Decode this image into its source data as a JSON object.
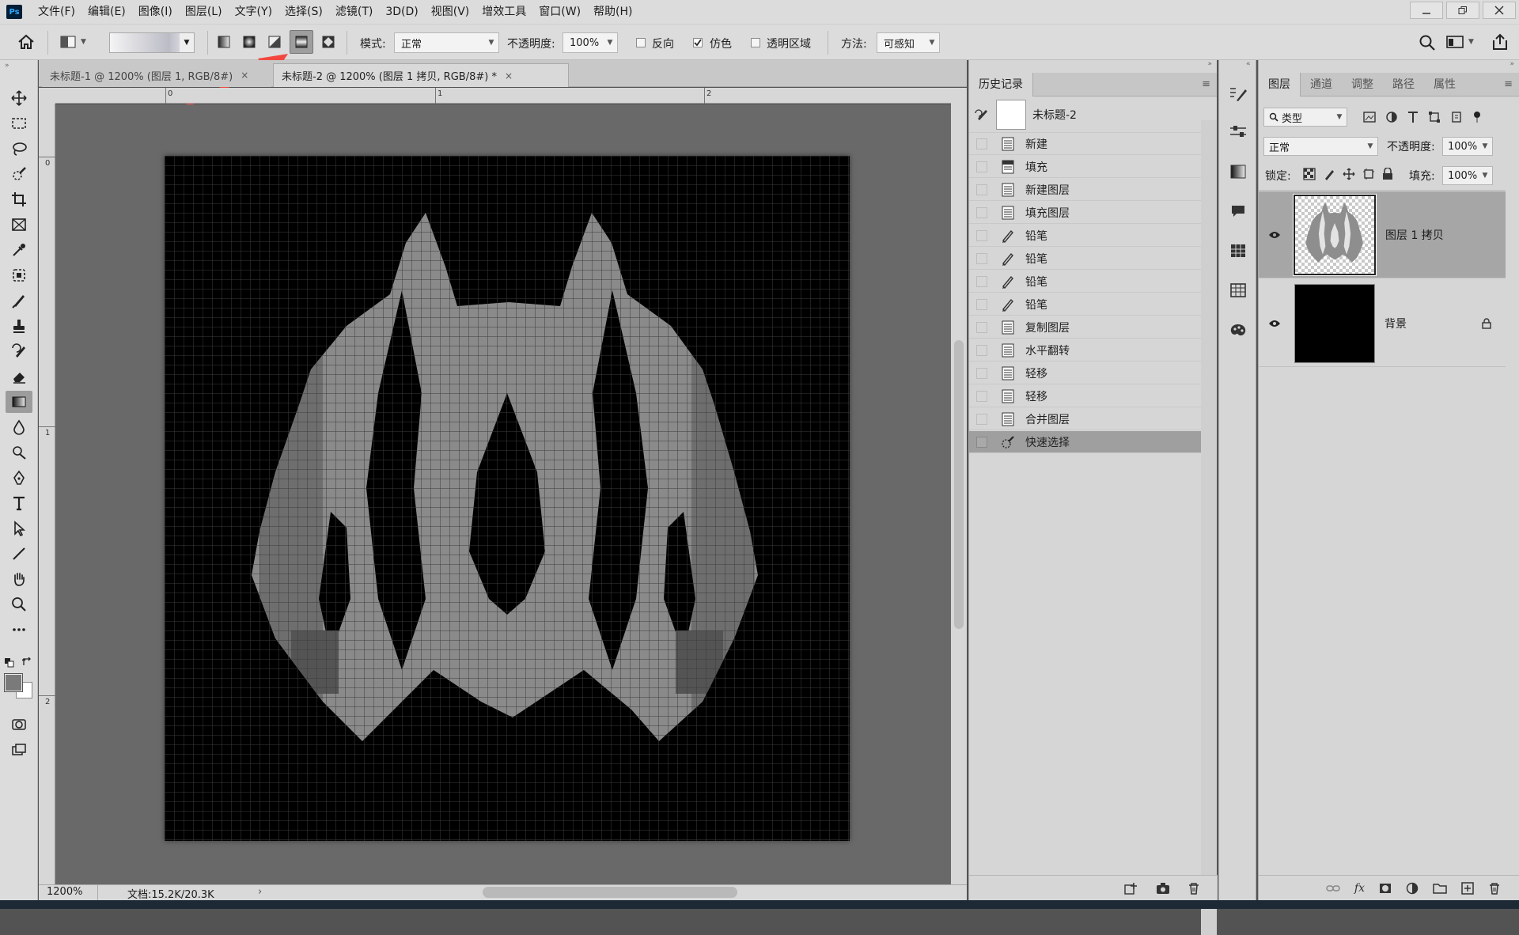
{
  "app": {
    "logo": "Ps"
  },
  "menu": [
    "文件(F)",
    "编辑(E)",
    "图像(I)",
    "图层(L)",
    "文字(Y)",
    "选择(S)",
    "滤镜(T)",
    "3D(D)",
    "视图(V)",
    "增效工具",
    "窗口(W)",
    "帮助(H)"
  ],
  "options": {
    "mode_label": "模式:",
    "mode_value": "正常",
    "opacity_label": "不透明度:",
    "opacity_value": "100%",
    "reverse_label": "反向",
    "reverse_checked": false,
    "dither_label": "仿色",
    "dither_checked": true,
    "transparency_label": "透明区域",
    "transparency_checked": false,
    "method_label": "方法:",
    "method_value": "可感知",
    "gradient_types": [
      "linear-gradient-icon",
      "radial-gradient-icon",
      "angle-gradient-icon",
      "reflected-gradient-icon",
      "diamond-gradient-icon"
    ],
    "selected_gradient_type": "reflected-gradient-icon"
  },
  "tabs": [
    {
      "label": "未标题-1 @ 1200% (图层 1, RGB/8#)",
      "close": "×",
      "active": false
    },
    {
      "label": "未标题-2 @ 1200% (图层 1 拷贝, RGB/8#) *",
      "close": "×",
      "active": true
    }
  ],
  "rulers": {
    "horizontal": [
      "0",
      "1",
      "2"
    ],
    "vertical": [
      "0",
      "1",
      "2"
    ]
  },
  "status": {
    "zoom": "1200%",
    "doc": "文档:15.2K/20.3K",
    "arrow": "›"
  },
  "history": {
    "tabs": [
      "历史记录"
    ],
    "snapshot_label": "未标题-2",
    "items": [
      {
        "label": "新建",
        "icon": "doc-icon"
      },
      {
        "label": "填充",
        "icon": "fill-doc-icon"
      },
      {
        "label": "新建图层",
        "icon": "doc-icon"
      },
      {
        "label": "填充图层",
        "icon": "doc-icon"
      },
      {
        "label": "铅笔",
        "icon": "pencil-icon"
      },
      {
        "label": "铅笔",
        "icon": "pencil-icon"
      },
      {
        "label": "铅笔",
        "icon": "pencil-icon"
      },
      {
        "label": "铅笔",
        "icon": "pencil-icon"
      },
      {
        "label": "复制图层",
        "icon": "doc-icon"
      },
      {
        "label": "水平翻转",
        "icon": "doc-icon"
      },
      {
        "label": "轻移",
        "icon": "doc-icon"
      },
      {
        "label": "轻移",
        "icon": "doc-icon"
      },
      {
        "label": "合并图层",
        "icon": "doc-icon"
      },
      {
        "label": "快速选择",
        "icon": "quick-select-icon",
        "selected": true
      }
    ]
  },
  "layers": {
    "tabs": [
      "图层",
      "通道",
      "调整",
      "路径",
      "属性"
    ],
    "filter_value": "类型",
    "blend_mode": "正常",
    "opacity_label": "不透明度:",
    "opacity_value": "100%",
    "lock_label": "锁定:",
    "fill_label": "填充:",
    "fill_value": "100%",
    "items": [
      {
        "name": "图层 1 拷贝",
        "selected": true,
        "visible": true,
        "locked": false
      },
      {
        "name": "背景",
        "selected": false,
        "visible": true,
        "locked": true
      }
    ]
  },
  "colors": {
    "accent_arrow": "#f2483f",
    "foreground": "#7a7a7a",
    "background": "#ffffff",
    "canvas_grid": "#3c3c3c",
    "pixel_light": "#8a8a8a",
    "pixel_mid": "#6e6e6e",
    "pixel_dark": "#545454"
  }
}
